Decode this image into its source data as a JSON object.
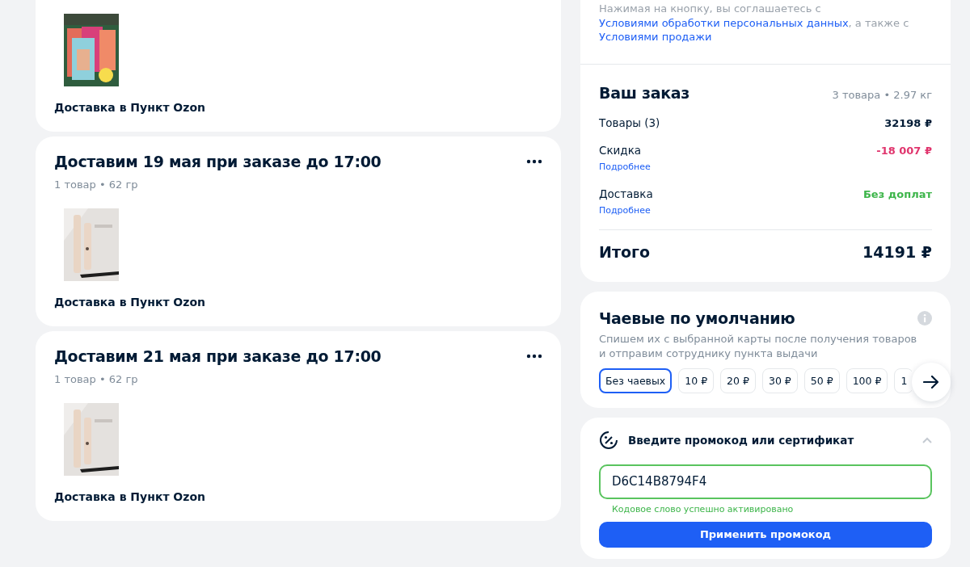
{
  "shipments": [
    {
      "delivery": "Доставка в Пункт Ozon"
    },
    {
      "title": "Доставим 19 мая при заказе до 17:00",
      "meta": "1 товар • 62 гр",
      "delivery": "Доставка в Пункт Ozon"
    },
    {
      "title": "Доставим 21 мая при заказе до 17:00",
      "meta": "1 товар • 62 гр",
      "delivery": "Доставка в Пункт Ozon"
    }
  ],
  "consent": [
    {
      "text": "Нажимая на кнопку, вы соглашаетесь с ",
      "link": false
    },
    {
      "text": "Условиями обработки персональных данных",
      "link": true
    },
    {
      "text": ", а также с ",
      "link": false
    },
    {
      "text": "Условиями продажи",
      "link": true
    }
  ],
  "order": {
    "title": "Ваш заказ",
    "summary": "3 товара • 2.97 кг",
    "lines": [
      {
        "label": "Товары (3)",
        "value": "32198 ₽",
        "color": "#001a34"
      },
      {
        "label": "Скидка",
        "value": "-18 007 ₽",
        "color": "#e0356d",
        "more": "Подробнее"
      },
      {
        "label": "Доставка",
        "value": "Без доплат",
        "color": "#3db54a",
        "more": "Подробнее"
      }
    ],
    "total_label": "Итого",
    "total": "14191 ₽"
  },
  "tips": {
    "title": "Чаевые по умолчанию",
    "description": "Спишем их с выбранной карты после получения товаров и отправим сотруднику пункта выдачи",
    "options": [
      {
        "label": "Без чаевых",
        "selected": true
      },
      {
        "label": "10 ₽",
        "selected": false
      },
      {
        "label": "20 ₽",
        "selected": false
      },
      {
        "label": "30 ₽",
        "selected": false
      },
      {
        "label": "50 ₽",
        "selected": false
      },
      {
        "label": "100 ₽",
        "selected": false
      },
      {
        "label": "1",
        "selected": false
      }
    ]
  },
  "promo": {
    "title": "Введите промокод или сертификат",
    "expanded": true,
    "value": "D6C14B8794F4",
    "status": "Кодовое слово успешно активировано",
    "button": "Применить промокод"
  }
}
